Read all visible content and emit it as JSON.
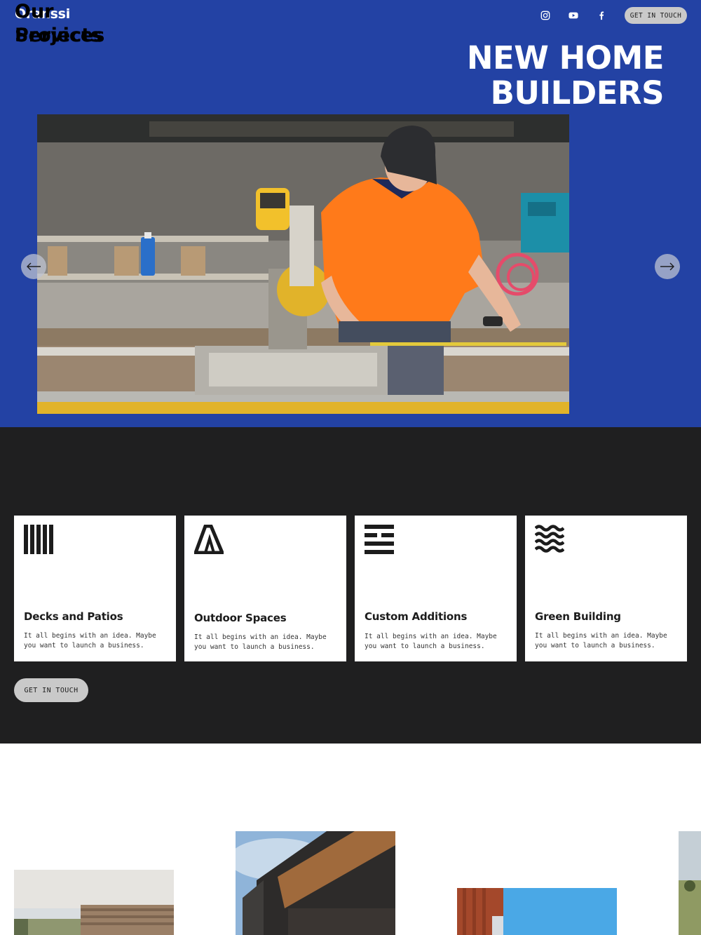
{
  "header": {
    "logo": "Oranssi",
    "social_icons": [
      "instagram-icon",
      "youtube-icon",
      "facebook-icon"
    ],
    "cta_label": "GET IN TOUCH"
  },
  "hero": {
    "title": "NEW HOME BUILDERS",
    "slide_image": "worker in orange shirt using a miter saw",
    "prev_icon": "arrow-left-icon",
    "next_icon": "arrow-right-icon"
  },
  "services": {
    "title": "Our\nServices",
    "cards": [
      {
        "icon": "vertical-bars-icon",
        "title": "Decks and Patios",
        "desc": "It all begins with an idea. Maybe you want to launch a business."
      },
      {
        "icon": "triangle-stripes-icon",
        "title": "Outdoor Spaces",
        "desc": "It all begins with an idea. Maybe you want to launch a business."
      },
      {
        "icon": "broken-lines-icon",
        "title": "Custom Additions",
        "desc": "It all begins with an idea. Maybe you want to launch a business."
      },
      {
        "icon": "waves-icon",
        "title": "Green Building",
        "desc": "It all begins with an idea. Maybe you want to launch a business."
      }
    ],
    "cta_label": "GET IN TOUCH"
  },
  "projects": {
    "title": "Our\nProjects"
  },
  "colors": {
    "hero_blue": "#2342a4",
    "services_dark": "#1f1f20",
    "button_grey": "#c9c9c9",
    "shirt_orange": "#ff7a1a"
  }
}
